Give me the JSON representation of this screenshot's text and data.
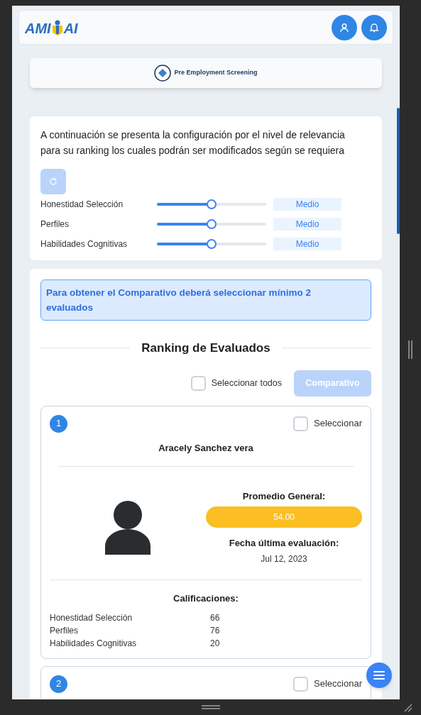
{
  "logo": {
    "left": "AMI",
    "right": "AI"
  },
  "module": {
    "title": "Pre Employment Screening"
  },
  "config": {
    "intro": "A continuación se presenta la configuración por el nivel de relevancia para su ranking los cuales podrán ser modificados según se requiera",
    "reset_disabled": true,
    "sliders": [
      {
        "label": "Honestidad Selección",
        "level": 0.5,
        "reading": "Medio"
      },
      {
        "label": "Perfiles",
        "level": 0.5,
        "reading": "Medio"
      },
      {
        "label": "Habilidades Cognitivas",
        "level": 0.5,
        "reading": "Medio"
      }
    ]
  },
  "notice": "Para obtener el Comparativo deberá seleccionar mínimo 2 evaluados",
  "ranking": {
    "title": "Ranking de Evaluados",
    "select_all": {
      "label": "Seleccionar todos",
      "checked": false
    },
    "compare_button": {
      "label": "Comparativo",
      "disabled": true
    },
    "candidates": [
      {
        "rank": "1",
        "select_label": "Seleccionar",
        "checked": false,
        "name": "Aracely Sanchez vera",
        "average_label": "Promedio General:",
        "average": "54.00",
        "date_label": "Fecha última evaluación:",
        "date": "Jul 12, 2023",
        "grades_label": "Calificaciones:",
        "grades": [
          {
            "label": "Honestidad Selección",
            "value": "66"
          },
          {
            "label": "Perfiles",
            "value": "76"
          },
          {
            "label": "Habilidades Cognitivas",
            "value": "20"
          }
        ]
      },
      {
        "rank": "2",
        "select_label": "Seleccionar",
        "checked": false
      }
    ]
  }
}
